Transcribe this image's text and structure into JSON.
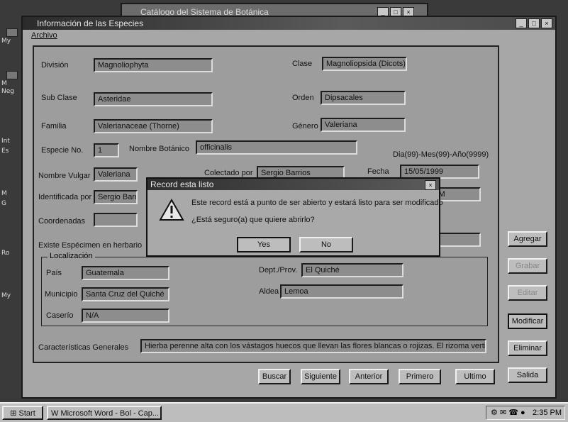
{
  "desktop": {
    "icons": [
      "My",
      "M",
      "Neg",
      "Int",
      "Es",
      "M",
      "G",
      "Ro",
      "My"
    ]
  },
  "back_window": {
    "title": "Catálogo del Sistema de Botánica",
    "controls": [
      "_",
      "□",
      "×"
    ]
  },
  "main_window": {
    "title": "Información de las Especies",
    "controls": [
      "_",
      "□",
      "×"
    ],
    "menu": {
      "file": "Archivo"
    },
    "form": {
      "division_label": "División",
      "division_value": "Magnoliophyta",
      "clase_label": "Clase",
      "clase_value": "Magnoliopsida (Dicots)",
      "subclase_label": "Sub Clase",
      "subclase_value": "Asteridae",
      "orden_label": "Orden",
      "orden_value": "Dipsacales",
      "familia_label": "Familia",
      "familia_value": "Valerianaceae (Thorne)",
      "genero_label": "Género",
      "genero_value": "Valeriana",
      "especie_no_label": "Especie No.",
      "especie_no_value": "1",
      "nombre_botanico_label": "Nombre Botánico",
      "nombre_botanico_value": "officinalis",
      "fecha_format": "Dia(99)-Mes(99)-Año(9999)",
      "nombre_vulgar_label": "Nombre Vulgar",
      "nombre_vulgar_value": "Valeriana",
      "colectado_label": "Colectado por",
      "colectado_value": "Sergio Barrios",
      "fecha_label": "Fecha",
      "fecha_value": "15/05/1999",
      "identificada_label": "Identificada por",
      "identificada_value": "Sergio Barrios",
      "herbario_value": "a SNM",
      "coordenadas_label": "Coordenadas",
      "herbario_question": "Existe Espécimen en herbario",
      "localizacion_label": "Localización",
      "pais_label": "País",
      "pais_value": "Guatemala",
      "depto_label": "Dept./Prov.",
      "depto_value": "El Quiché",
      "municipio_label": "Municipio",
      "municipio_value": "Santa Cruz del Quiché",
      "aldea_label": "Aldea",
      "aldea_value": "Lemoa",
      "caserio_label": "Caserío",
      "caserio_value": "N/A",
      "caracteristicas_label": "Características Generales",
      "caracteristicas_value": "Hierba perenne alta con los vástagos huecos que llevan las flores blancas o rojizas. El rizoma vertica"
    },
    "side_buttons": {
      "agregar": "Agregar",
      "grabar": "Grabar",
      "editar": "Editar",
      "modificar": "Modificar",
      "eliminar": "Eliminar",
      "salida": "Salida"
    },
    "nav_buttons": {
      "buscar": "Buscar",
      "siguiente": "Siguiente",
      "anterior": "Anterior",
      "primero": "Primero",
      "ultimo": "Ultimo"
    }
  },
  "dialog": {
    "title": "Record esta listo",
    "message1": "Este record está a punto de ser abierto y estará listo para ser modificado",
    "message2": "¿Está seguro(a) que quiere abrirlo?",
    "yes_label": "Yes",
    "no_label": "No",
    "close": "×"
  },
  "taskbar": {
    "start_label": "Start",
    "task_label": "Microsoft Word - Bol - Cap...",
    "tray_icons": "⚙ ✉ ☎ ●",
    "clock": "2:35 PM"
  }
}
